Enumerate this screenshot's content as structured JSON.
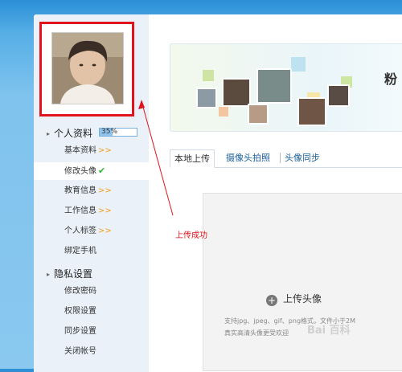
{
  "sidebar": {
    "profile_group": {
      "title": "个人资料",
      "progress_text": "35%",
      "progress": 0.35
    },
    "profile_items": [
      {
        "label": "基本资料",
        "chevron": ">>"
      },
      {
        "label": "修改头像",
        "check": "✔"
      },
      {
        "label": "教育信息",
        "chevron": ">>"
      },
      {
        "label": "工作信息",
        "chevron": ">>"
      },
      {
        "label": "个人标签",
        "chevron": ">>"
      },
      {
        "label": "绑定手机"
      }
    ],
    "privacy_group": {
      "title": "隐私设置"
    },
    "privacy_items": [
      {
        "label": "修改密码"
      },
      {
        "label": "权限设置"
      },
      {
        "label": "同步设置"
      },
      {
        "label": "关闭帐号"
      }
    ]
  },
  "banner": {
    "title": "粉"
  },
  "tabs": [
    {
      "label": "本地上传"
    },
    {
      "label": "摄像头拍照"
    },
    {
      "label": "头像同步"
    }
  ],
  "upload": {
    "button_label": "上传头像",
    "hint_line1": "支持jpg、jpeg、gif、png格式，文件小于2M",
    "hint_line2": "真实高清头像更受欢迎"
  },
  "annotation": {
    "text": "上传成功",
    "color": "#e2141b"
  },
  "watermark": {
    "text": "Bai 百科"
  },
  "colors": {
    "accent": "#1a5e9a",
    "highlight": "#e2141b",
    "check": "#2db52d",
    "chevron": "#f39c1a"
  }
}
